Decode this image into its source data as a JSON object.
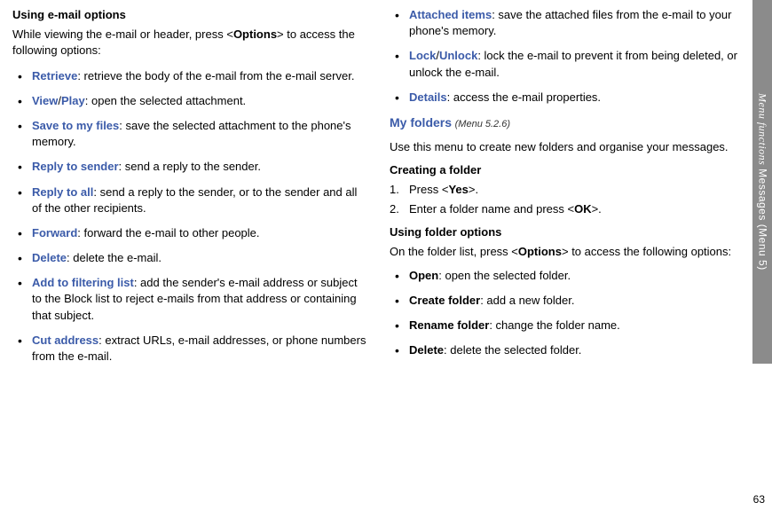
{
  "leftColumn": {
    "sectionTitle": "Using e-mail options",
    "introPart1": "While viewing the e-mail or header, press <",
    "introOptions": "Options",
    "introPart2": "> to access the following options:",
    "options": [
      {
        "name": "Retrieve",
        "desc": ": retrieve the body of the e-mail from the e-mail server.",
        "colored": true
      },
      {
        "name": "View/Play",
        "desc": ": open the selected attachment.",
        "colored": true,
        "slashName1": "View",
        "slashName2": "Play"
      },
      {
        "name": "Save to my files",
        "desc": ": save the selected attachment to the phone's memory.",
        "colored": true
      },
      {
        "name": "Reply to sender",
        "desc": ": send a reply to the sender.",
        "colored": true
      },
      {
        "name": "Reply to all",
        "desc": ": send a reply to the sender, or to the sender and all of the other recipients.",
        "colored": true
      },
      {
        "name": "Forward",
        "desc": ": forward the e-mail to other people.",
        "colored": true
      },
      {
        "name": "Delete",
        "desc": ": delete the e-mail.",
        "colored": true
      },
      {
        "name": "Add to filtering list",
        "desc": ": add the sender's e-mail address or subject to the Block list to reject e-mails from that address or containing that subject.",
        "colored": true
      },
      {
        "name": "Cut address",
        "desc": ": extract URLs, e-mail addresses, or phone numbers from the e-mail.",
        "colored": true
      }
    ]
  },
  "rightColumn": {
    "topOptions": [
      {
        "name": "Attached items",
        "desc": ": save the attached files from the e-mail to your phone's memory.",
        "colored": true
      },
      {
        "name": "Lock/Unlock",
        "desc": ": lock the e-mail to prevent it from being deleted, or unlock the e-mail.",
        "colored": true,
        "slashName1": "Lock",
        "slashName2": "Unlock"
      },
      {
        "name": "Details",
        "desc": ": access the e-mail properties.",
        "colored": true
      }
    ],
    "myFoldersTitle": "My folders",
    "myFoldersMenuRef": "(Menu 5.2.6)",
    "myFoldersDesc": "Use this menu to create new folders and organise your messages.",
    "creatingTitle": "Creating a folder",
    "step1Num": "1.",
    "step1Part1": "Press <",
    "step1Yes": "Yes",
    "step1Part2": ">.",
    "step2Num": "2.",
    "step2Part1": "Enter a folder name and press <",
    "step2OK": "OK",
    "step2Part2": ">.",
    "usingTitle": "Using folder options",
    "folderIntroPart1": "On the folder list, press <",
    "folderIntroOptions": "Options",
    "folderIntroPart2": "> to access the following options:",
    "folderOptions": [
      {
        "name": "Open",
        "desc": ": open the selected folder."
      },
      {
        "name": "Create folder",
        "desc": ": add a new folder."
      },
      {
        "name": "Rename folder",
        "desc": ": change the folder name."
      },
      {
        "name": "Delete",
        "desc": ": delete the selected folder."
      }
    ]
  },
  "sideTab": {
    "italic": "Menu functions",
    "regular": "    Messages (Menu 5)"
  },
  "pageNumber": "63"
}
